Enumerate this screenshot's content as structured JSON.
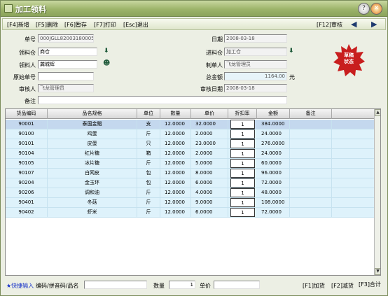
{
  "window": {
    "title": "加工领料"
  },
  "toolbar": {
    "add": "[F4]新增",
    "delete": "[F5]删除",
    "stash": "[F6]暂存",
    "print": "[F7]打印",
    "exit": "[Esc]退出",
    "review": "[F12]审核"
  },
  "form": {
    "doc_no": {
      "label": "单号",
      "value": "000JGLL82003180005"
    },
    "date": {
      "label": "日期",
      "value": "2008-03-18"
    },
    "source_wh": {
      "label": "领料仓",
      "value": "商仓"
    },
    "process_wh": {
      "label": "进料仓",
      "value": "加工仓"
    },
    "receiver": {
      "label": "领料人",
      "value": "龚城辉"
    },
    "creator": {
      "label": "制单人",
      "value": "飞龙管理员"
    },
    "orig_no": {
      "label": "原始单号",
      "value": ""
    },
    "total": {
      "label": "总金额",
      "value": "1164.00",
      "unit": "元"
    },
    "auditor": {
      "label": "审核人",
      "value": "飞龙管理员"
    },
    "audit_date": {
      "label": "审核日期",
      "value": "2008-03-18"
    },
    "remark": {
      "label": "备注",
      "value": ""
    }
  },
  "stamp": {
    "line1": "草稿",
    "line2": "状态"
  },
  "table": {
    "headers": [
      "货品编码",
      "品名规格",
      "单位",
      "数量",
      "单价",
      "折扣率",
      "金额",
      "备注"
    ],
    "rows": [
      [
        "90001",
        "泰国金鲳",
        "支",
        "12.0000",
        "32.0000",
        "1",
        "384.0000",
        ""
      ],
      [
        "90100",
        "鸡蛋",
        "斤",
        "12.0000",
        "2.0000",
        "1",
        "24.0000",
        ""
      ],
      [
        "90101",
        "皮蛋",
        "只",
        "12.0000",
        "23.0000",
        "1",
        "276.0000",
        ""
      ],
      [
        "90104",
        "红片糖",
        "箱",
        "12.0000",
        "2.0000",
        "1",
        "24.0000",
        ""
      ],
      [
        "90105",
        "冰片糖",
        "斤",
        "12.0000",
        "5.0000",
        "1",
        "60.0000",
        ""
      ],
      [
        "90107",
        "白网皮",
        "包",
        "12.0000",
        "8.0000",
        "1",
        "96.0000",
        ""
      ],
      [
        "90204",
        "金玉环",
        "包",
        "12.0000",
        "6.0000",
        "1",
        "72.0000",
        ""
      ],
      [
        "90206",
        "调和油",
        "斤",
        "12.0000",
        "4.0000",
        "1",
        "48.0000",
        ""
      ],
      [
        "90401",
        "冬菇",
        "斤",
        "12.0000",
        "9.0000",
        "1",
        "108.0000",
        ""
      ],
      [
        "90402",
        "虾米",
        "斤",
        "12.0000",
        "6.0000",
        "1",
        "72.0000",
        ""
      ]
    ]
  },
  "footer": {
    "quick_label": "★快捷输入",
    "quick_hint": "编码/拼音码/品名",
    "qty_label": "数量",
    "qty_value": "1",
    "price_label": "单价",
    "price_value": "",
    "add_goods": "[F1]加货",
    "reduce_goods": "[F2]减货",
    "total_key": "[F3]合计"
  },
  "colors": {
    "selected_row": "#c4d8ee",
    "row_bg": "#def2fb",
    "accent": "#c81e1e"
  }
}
